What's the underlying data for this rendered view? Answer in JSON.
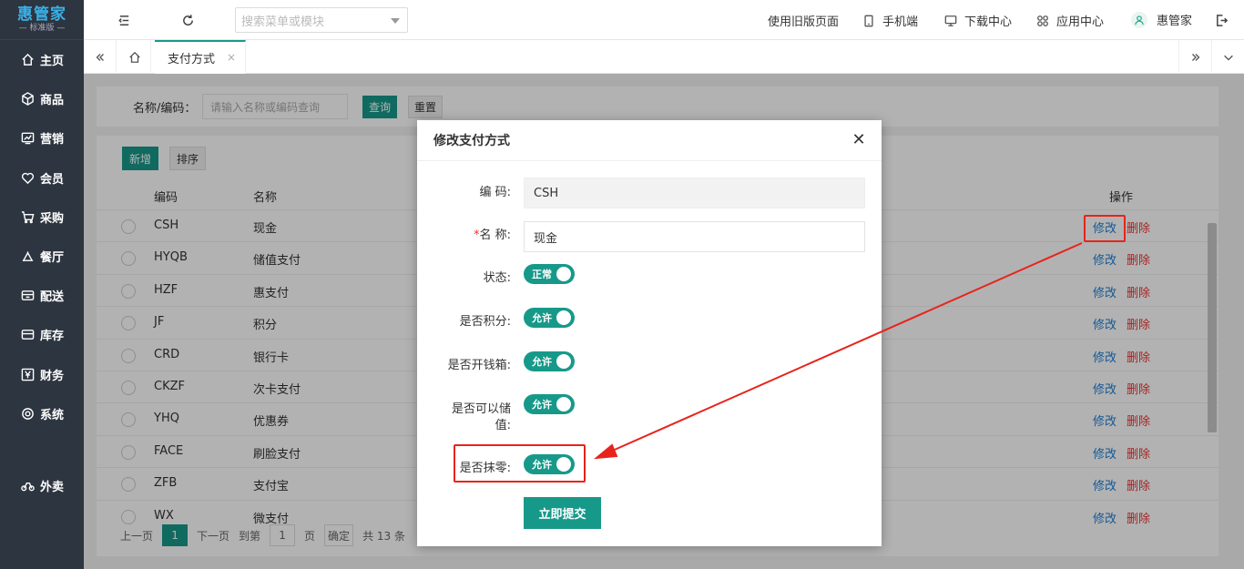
{
  "brand": {
    "name": "惠管家",
    "edition": "— 标准版 —"
  },
  "sidebar": {
    "items": [
      {
        "label": "主页",
        "icon": "home-icon"
      },
      {
        "label": "商品",
        "icon": "box-icon"
      },
      {
        "label": "营销",
        "icon": "chart-icon"
      },
      {
        "label": "会员",
        "icon": "heart-icon"
      },
      {
        "label": "采购",
        "icon": "cart-icon"
      },
      {
        "label": "餐厅",
        "icon": "bell-icon"
      },
      {
        "label": "配送",
        "icon": "truck-icon"
      },
      {
        "label": "库存",
        "icon": "inventory-icon"
      },
      {
        "label": "财务",
        "icon": "yen-icon"
      },
      {
        "label": "系统",
        "icon": "settings-icon"
      },
      {
        "label": "外卖",
        "icon": "bike-icon"
      }
    ]
  },
  "topbar": {
    "search_placeholder": "搜索菜单或模块",
    "old_version": "使用旧版页面",
    "mobile": "手机端",
    "download": "下载中心",
    "apps": "应用中心",
    "user": "惠管家"
  },
  "tabs": {
    "active": "支付方式",
    "close": "×"
  },
  "page": {
    "filter_label": "名称/编码：",
    "filter_placeholder": "请输入名称或编码查询",
    "query_btn": "查询",
    "reset_btn": "重置",
    "add_btn": "新增",
    "sort_btn": "排序",
    "col_code": "编码",
    "col_name": "名称",
    "col_ops": "操作",
    "edit_label": "修改",
    "delete_label": "删除",
    "rows": [
      {
        "code": "CSH",
        "name": "现金"
      },
      {
        "code": "HYQB",
        "name": "储值支付"
      },
      {
        "code": "HZF",
        "name": "惠支付"
      },
      {
        "code": "JF",
        "name": "积分"
      },
      {
        "code": "CRD",
        "name": "银行卡"
      },
      {
        "code": "CKZF",
        "name": "次卡支付"
      },
      {
        "code": "YHQ",
        "name": "优惠券"
      },
      {
        "code": "FACE",
        "name": "刷脸支付"
      },
      {
        "code": "ZFB",
        "name": "支付宝"
      },
      {
        "code": "WX",
        "name": "微支付"
      }
    ],
    "pager": {
      "prev": "上一页",
      "current": "1",
      "next": "下一页",
      "goto": "到第",
      "page_input": "1",
      "page_unit": "页",
      "confirm": "确定",
      "total": "共 13 条"
    }
  },
  "modal": {
    "title": "修改支付方式",
    "fields": {
      "code_label": "编 码:",
      "code_value": "CSH",
      "name_required": "*",
      "name_label": "名 称:",
      "name_value": "现金",
      "status_label": "状态:",
      "status_value": "正常",
      "points_label": "是否积分:",
      "points_value": "允许",
      "cashbox_label": "是否开钱箱:",
      "cashbox_value": "允许",
      "stored_label": "是否可以储值:",
      "stored_value": "允许",
      "rounding_label": "是否抹零:",
      "rounding_value": "允许"
    },
    "submit": "立即提交"
  },
  "colors": {
    "accent": "#17998a",
    "sidebar_bg": "#2d3540",
    "highlight": "#e8231b",
    "edit_link": "#1e7fd6",
    "delete_link": "#ee3333"
  }
}
